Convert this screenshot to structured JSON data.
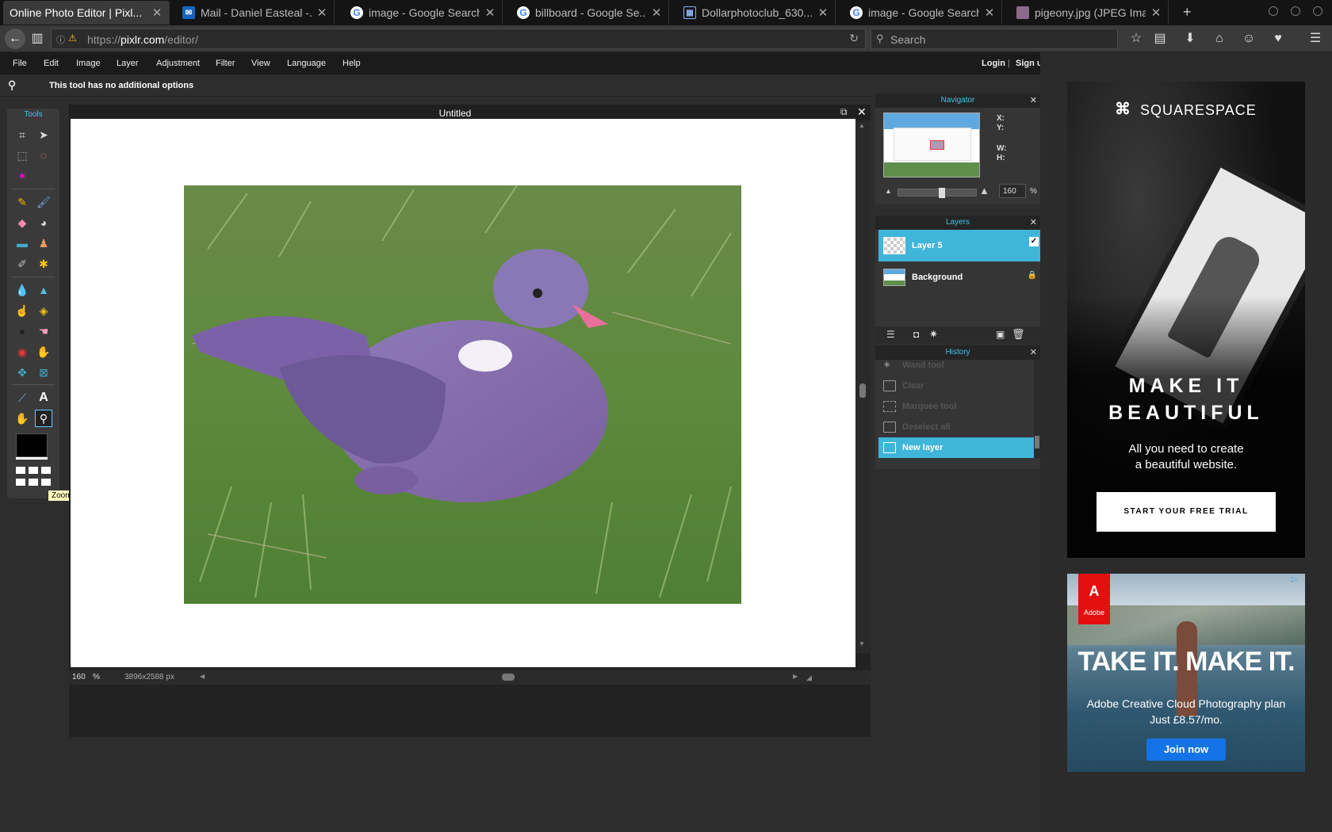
{
  "browser": {
    "tabs": [
      {
        "title": "Online Photo Editor | Pixl...",
        "icon": "pixlr-icon",
        "active": true
      },
      {
        "title": "Mail - Daniel Easteal -...",
        "icon": "mail-icon"
      },
      {
        "title": "image - Google Search",
        "icon": "google-icon"
      },
      {
        "title": "billboard - Google Se...",
        "icon": "google-icon"
      },
      {
        "title": "Dollarphotoclub_630...",
        "icon": "grid-icon"
      },
      {
        "title": "image - Google Search",
        "icon": "google-icon"
      },
      {
        "title": "pigeony.jpg (JPEG Ima...",
        "icon": "image-icon"
      }
    ],
    "url_prefix": "https://",
    "url_host": "pixlr.com",
    "url_path": "/editor/",
    "search_placeholder": "Search"
  },
  "menu": {
    "items": [
      "File",
      "Edit",
      "Image",
      "Layer",
      "Adjustment",
      "Filter",
      "View",
      "Language",
      "Help"
    ],
    "login": "Login",
    "signup": "Sign up"
  },
  "options_bar": {
    "text": "This tool has no additional options"
  },
  "tools": {
    "title": "Tools",
    "tooltip": "Zoom tool (Z)",
    "foreground_color": "#000000",
    "background_color": "#ffffff"
  },
  "document": {
    "title": "Untitled",
    "zoom": "160",
    "zoom_unit": "%",
    "dimensions": "3896x2588 px"
  },
  "navigator": {
    "title": "Navigator",
    "x_label": "X:",
    "y_label": "Y:",
    "w_label": "W:",
    "h_label": "H:",
    "zoom_value": "160",
    "zoom_unit": "%",
    "zoom_slider_fraction": 0.55
  },
  "layers": {
    "title": "Layers",
    "items": [
      {
        "name": "Layer 5",
        "selected": true
      },
      {
        "name": "Background",
        "selected": false
      }
    ]
  },
  "history": {
    "title": "History",
    "items": [
      {
        "label": "Wand tool",
        "selected": false
      },
      {
        "label": "Clear",
        "selected": false
      },
      {
        "label": "Marquee tool",
        "selected": false
      },
      {
        "label": "Deselect all",
        "selected": false
      },
      {
        "label": "New layer",
        "selected": true
      }
    ]
  },
  "ads": {
    "squarespace": {
      "brand": "SQUARESPACE",
      "headline1": "MAKE IT",
      "headline2": "BEAUTIFUL",
      "sub1": "All you need to create",
      "sub2": "a beautiful website.",
      "cta": "START YOUR FREE TRIAL"
    },
    "adobe": {
      "brand": "Adobe",
      "headline": "TAKE IT. MAKE IT.",
      "sub1": "Adobe Creative Cloud Photography plan",
      "sub2": "Just £8.57/mo.",
      "cta": "Join now"
    }
  },
  "colors": {
    "accent": "#3fb5d9",
    "panel_title": "#3ec5e8",
    "adobe_red": "#e4100f",
    "adobe_button": "#1473e6"
  }
}
